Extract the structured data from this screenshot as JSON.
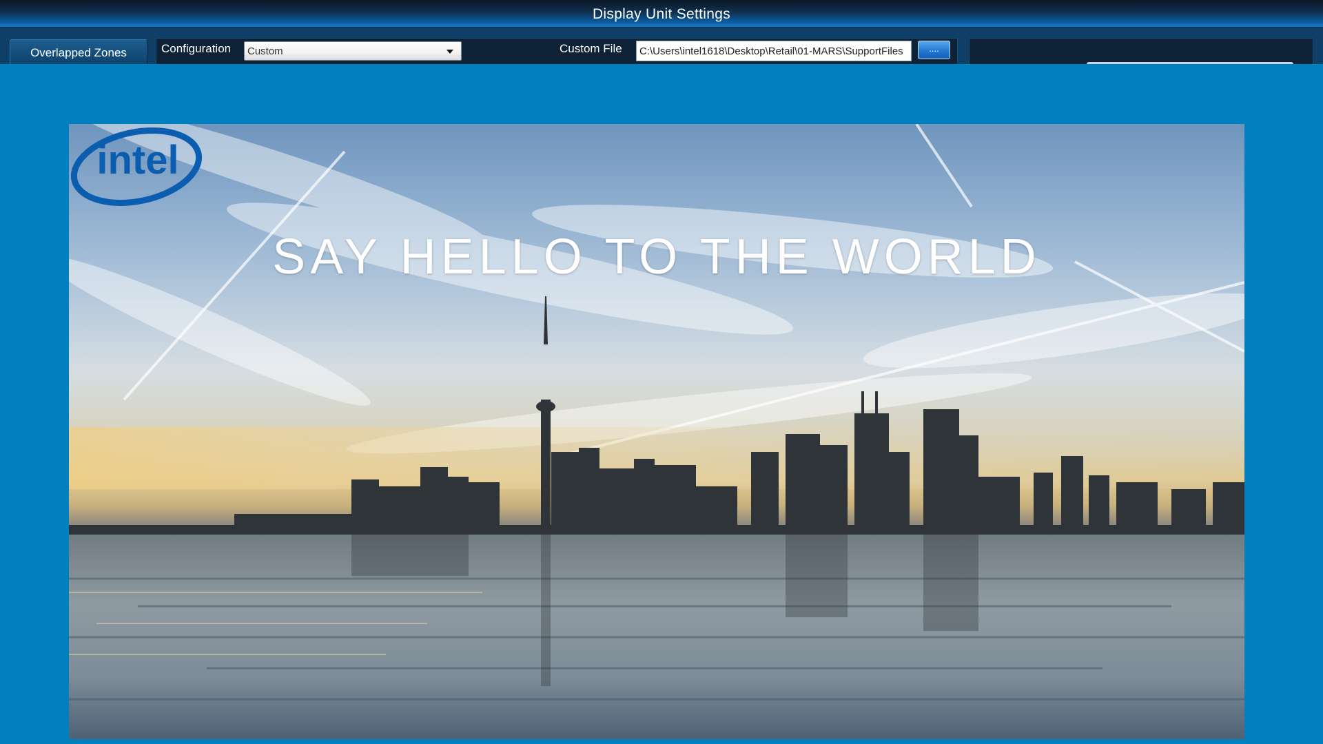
{
  "window": {
    "title": "Display Unit Settings"
  },
  "toolbar": {
    "tab_label": "Overlapped Zones",
    "configuration_label": "Configuration",
    "configuration_value": "Custom",
    "custom_file_label": "Custom File",
    "custom_file_value": "C:\\Users\\intel1618\\Desktop\\Retail\\01-MARS\\SupportFiles",
    "browse_label": "...."
  },
  "preview": {
    "headline": "SAY HELLO TO THE WORLD",
    "logo_text": "intel"
  },
  "colors": {
    "background": "#0080bf",
    "toolbar": "#0f3f66",
    "titlebar_dark": "#0a1726",
    "titlebar_light": "#1677c8",
    "logo_blue": "#0b5db0"
  }
}
